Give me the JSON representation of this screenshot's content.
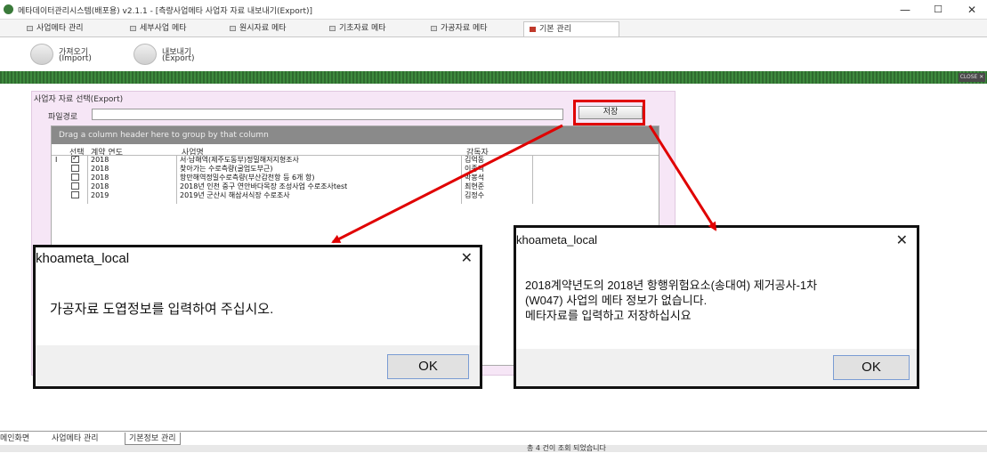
{
  "window": {
    "title": "메타데이터관리시스템(배포용) v2.1.1 - [측량사업메타 사업자 자료 내보내기(Export)]",
    "minimize": "—",
    "maximize": "☐",
    "close": "✕"
  },
  "menu_tabs": [
    {
      "label": "사업메타 관리"
    },
    {
      "label": "세부사업 메타"
    },
    {
      "label": "원시자료 메타"
    },
    {
      "label": "기초자료 메타"
    },
    {
      "label": "가공자료 메타"
    },
    {
      "label": "기본 관리"
    }
  ],
  "ribbon": {
    "import_line1": "가져오기",
    "import_line2": "(Import)",
    "export_line1": "내보내기",
    "export_line2": "(Export)"
  },
  "close_label": "CLOSE ✕",
  "panel": {
    "title": "사업자 자료 선택(Export)",
    "path_label": "파일경로",
    "path_value": "",
    "save_label": "저장"
  },
  "grid": {
    "group_hint": "Drag a column header here to group by that column",
    "headers": [
      "선택",
      "계약 연도",
      "사업명",
      "감독자"
    ],
    "rows": [
      {
        "checked": true,
        "year": "2018",
        "name": "서·남해역(제주도동부)정밀해저지형조사",
        "supervisor": "김억동"
      },
      {
        "checked": false,
        "year": "2018",
        "name": "찾아가는 수로측량(굴업도부근)",
        "supervisor": "이종직"
      },
      {
        "checked": false,
        "year": "2018",
        "name": "항만해역정밀수로측량(부산감천항 등 6개 항)",
        "supervisor": "박봉석"
      },
      {
        "checked": false,
        "year": "2018",
        "name": "2018년 인천 중구 연안바다목장 조성사업 수로조사test",
        "supervisor": "최현준"
      },
      {
        "checked": false,
        "year": "2019",
        "name": "2019년 군산시 해삼서식장 수로조사",
        "supervisor": "김정수"
      }
    ],
    "row_marker": "I"
  },
  "bottom_tabs": [
    {
      "label": "메인화면"
    },
    {
      "label": "사업메타 관리"
    },
    {
      "label": "기본정보 관리"
    }
  ],
  "status": "총 4 건이 조회 되었습니다",
  "dialog_left": {
    "title": "khoameta_local",
    "message": "가공자료 도엽정보를 입력하여 주십시오.",
    "ok": "OK"
  },
  "dialog_right": {
    "title": "khoameta_local",
    "line1": "2018계약년도의  2018년 항행위험요소(송대여) 제거공사-1차",
    "line2": "(W047) 사업의 메타 정보가 없습니다.",
    "line3": "메타자료를 입력하고 저장하십시요",
    "ok": "OK"
  },
  "colors": {
    "annotation": "#e00000",
    "green_bar": "#2f6b2f"
  }
}
